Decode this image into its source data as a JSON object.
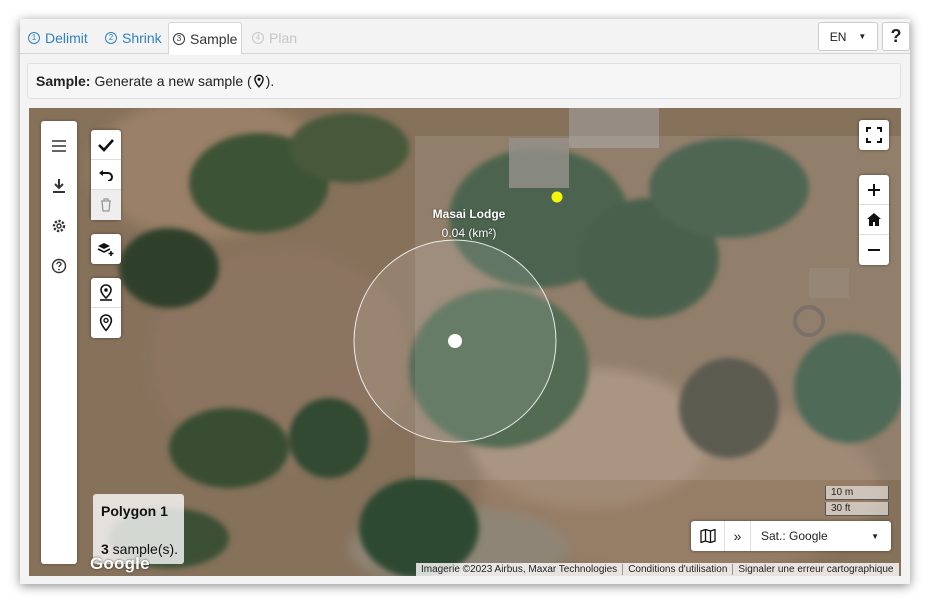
{
  "tabs": [
    {
      "num": "1",
      "label": "Delimit",
      "state": "normal"
    },
    {
      "num": "2",
      "label": "Shrink",
      "state": "normal"
    },
    {
      "num": "3",
      "label": "Sample",
      "state": "active"
    },
    {
      "num": "4",
      "label": "Plan",
      "state": "disabled"
    }
  ],
  "header": {
    "language": "EN",
    "help_label": "?"
  },
  "info": {
    "bold": "Sample:",
    "text_before": "Generate a new sample (",
    "text_after": ")."
  },
  "map": {
    "site_name": "Masai Lodge",
    "site_area": "0.04 (km²)",
    "polygon_card": {
      "title": "Polygon 1",
      "count": "3",
      "suffix": " sample(s)."
    },
    "google_logo": "Google",
    "scale": {
      "metric": "10 m",
      "imperial": "30 ft"
    },
    "basemap": {
      "selected": "Sat.: Google"
    },
    "attribution": [
      "Imagerie ©2023 Airbus, Maxar Technologies",
      "Conditions d'utilisation",
      "Signaler une erreur cartographique"
    ],
    "colors": {
      "sample_point": "#ffffff",
      "marker": "#f5f50c",
      "accent": "#2e82c4"
    }
  }
}
